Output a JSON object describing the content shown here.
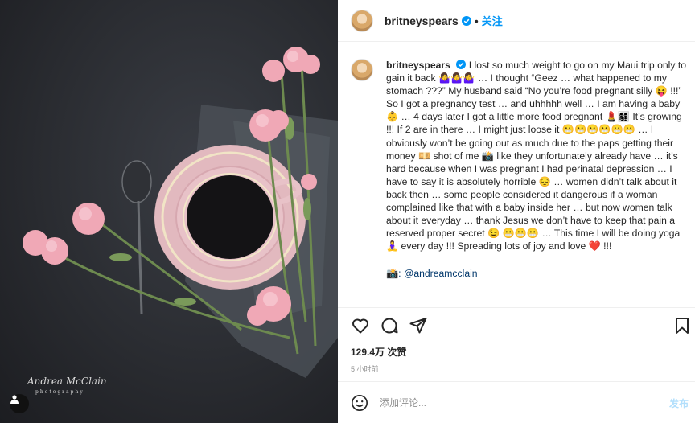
{
  "post": {
    "photo": {
      "watermark_main": "Andrea McClain",
      "watermark_sub": "photography"
    },
    "header": {
      "username": "britneyspears",
      "separator": "•",
      "follow_label": "关注"
    },
    "caption": {
      "username": "britneyspears",
      "text": "I lost so much weight to go on my Maui trip only to gain it back 🤷‍♀️🤷‍♀️🤷‍♀️ … I thought “Geez … what happened to my stomach ???” My husband said “No you’re food pregnant silly 😝 !!!” So I got a pregnancy test … and uhhhhh well … I am having a baby 👶 … 4 days later I got a little more food pregnant 💄👩‍👩‍👧‍👦 It’s growing !!! If 2 are in there … I might just loose it 😬😬😬😬😬😬 … I obviously won’t be going out as much due to the paps getting their money 💴 shot of me 📸 like they unfortunately already have … it’s hard because when I was pregnant I had perinatal depression … I have to say it is absolutely horrible 😔 … women didn’t talk about it back then … some people considered it dangerous if a woman complained like that with a baby inside her … but now women talk about it everyday … thank Jesus we don’t have to keep that pain a reserved proper secret 😉 😬😬😬 … This time I will be doing yoga 🧘‍♀️ every day !!! Spreading lots of joy and love ❤️ !!!",
      "credit": "📸: @andreamcclain"
    },
    "likes": "129.4万 次赞",
    "timestamp": "5 小时前",
    "comment": {
      "placeholder": "添加评论...",
      "post_label": "发布"
    },
    "icons": {
      "like": "heart-icon",
      "comment": "comment-icon",
      "share": "send-icon",
      "save": "bookmark-icon",
      "emoji": "emoji-icon",
      "tagged_users": "user-icon",
      "verified": "verified-badge-icon"
    },
    "colors": {
      "accent": "#0095f6",
      "post_disabled": "#b2dffc",
      "credit_link": "#00376b",
      "muted": "#8e8e8e"
    }
  }
}
